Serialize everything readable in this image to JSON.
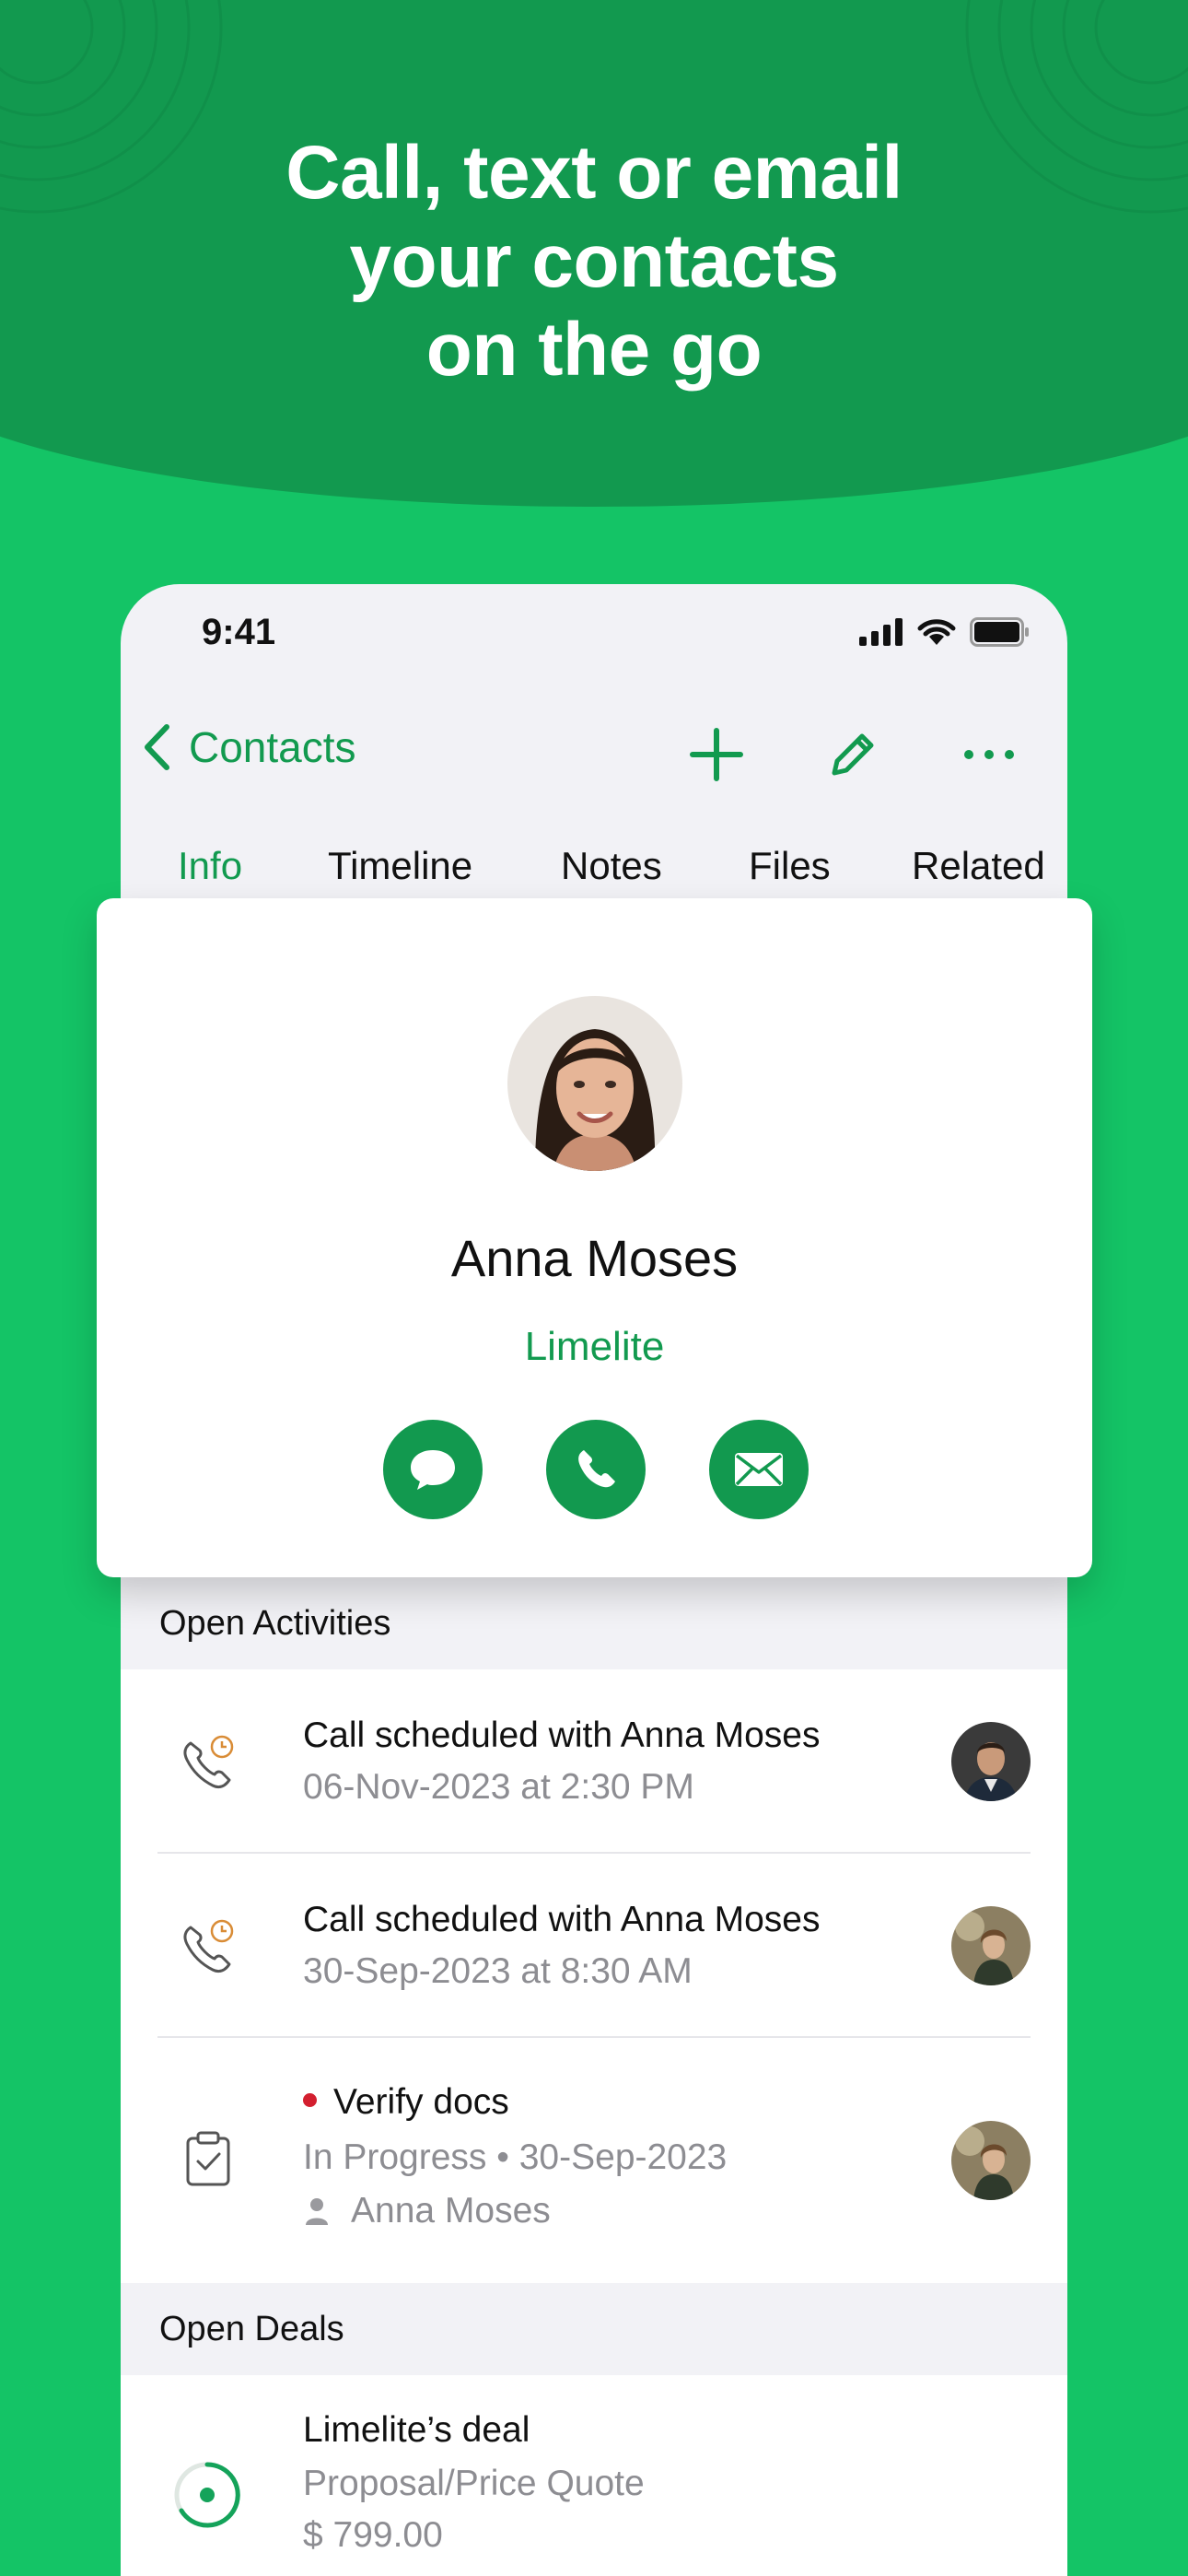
{
  "headline": {
    "line1": "Call, text or email",
    "line2": "your contacts",
    "line3": "on the go"
  },
  "status_bar": {
    "time": "9:41"
  },
  "nav": {
    "back_label": "Contacts",
    "icons": [
      "chevron-left-icon",
      "plus-icon",
      "pencil-icon",
      "more-icon"
    ]
  },
  "tabs": [
    {
      "label": "Info",
      "active": true
    },
    {
      "label": "Timeline",
      "active": false
    },
    {
      "label": "Notes",
      "active": false
    },
    {
      "label": "Files",
      "active": false
    },
    {
      "label": "Related",
      "active": false
    }
  ],
  "contact": {
    "name": "Anna Moses",
    "company": "Limelite",
    "actions": [
      "message-icon",
      "phone-icon",
      "mail-icon"
    ]
  },
  "open_activities": {
    "title": "Open Activities",
    "items": [
      {
        "title": "Call scheduled with Anna Moses",
        "subtitle": "06-Nov-2023 at 2:30 PM",
        "icon": "scheduled-call-icon"
      },
      {
        "title": "Call scheduled with Anna Moses",
        "subtitle": "30-Sep-2023 at 8:30 AM",
        "icon": "scheduled-call-icon"
      },
      {
        "title": "Verify docs",
        "status": "In Progress • 30-Sep-2023",
        "owner": "Anna Moses",
        "icon": "task-clipboard-icon"
      }
    ]
  },
  "open_deals": {
    "title": "Open Deals",
    "items": [
      {
        "title": "Limelite’s deal",
        "stage": "Proposal/Price Quote",
        "amount": "$ 799.00",
        "icon": "deal-progress-icon"
      }
    ]
  },
  "colors": {
    "background_green": "#14c466",
    "band_green": "#12994f",
    "accent_green": "#129a4f",
    "priority_red": "#d31f2f"
  }
}
